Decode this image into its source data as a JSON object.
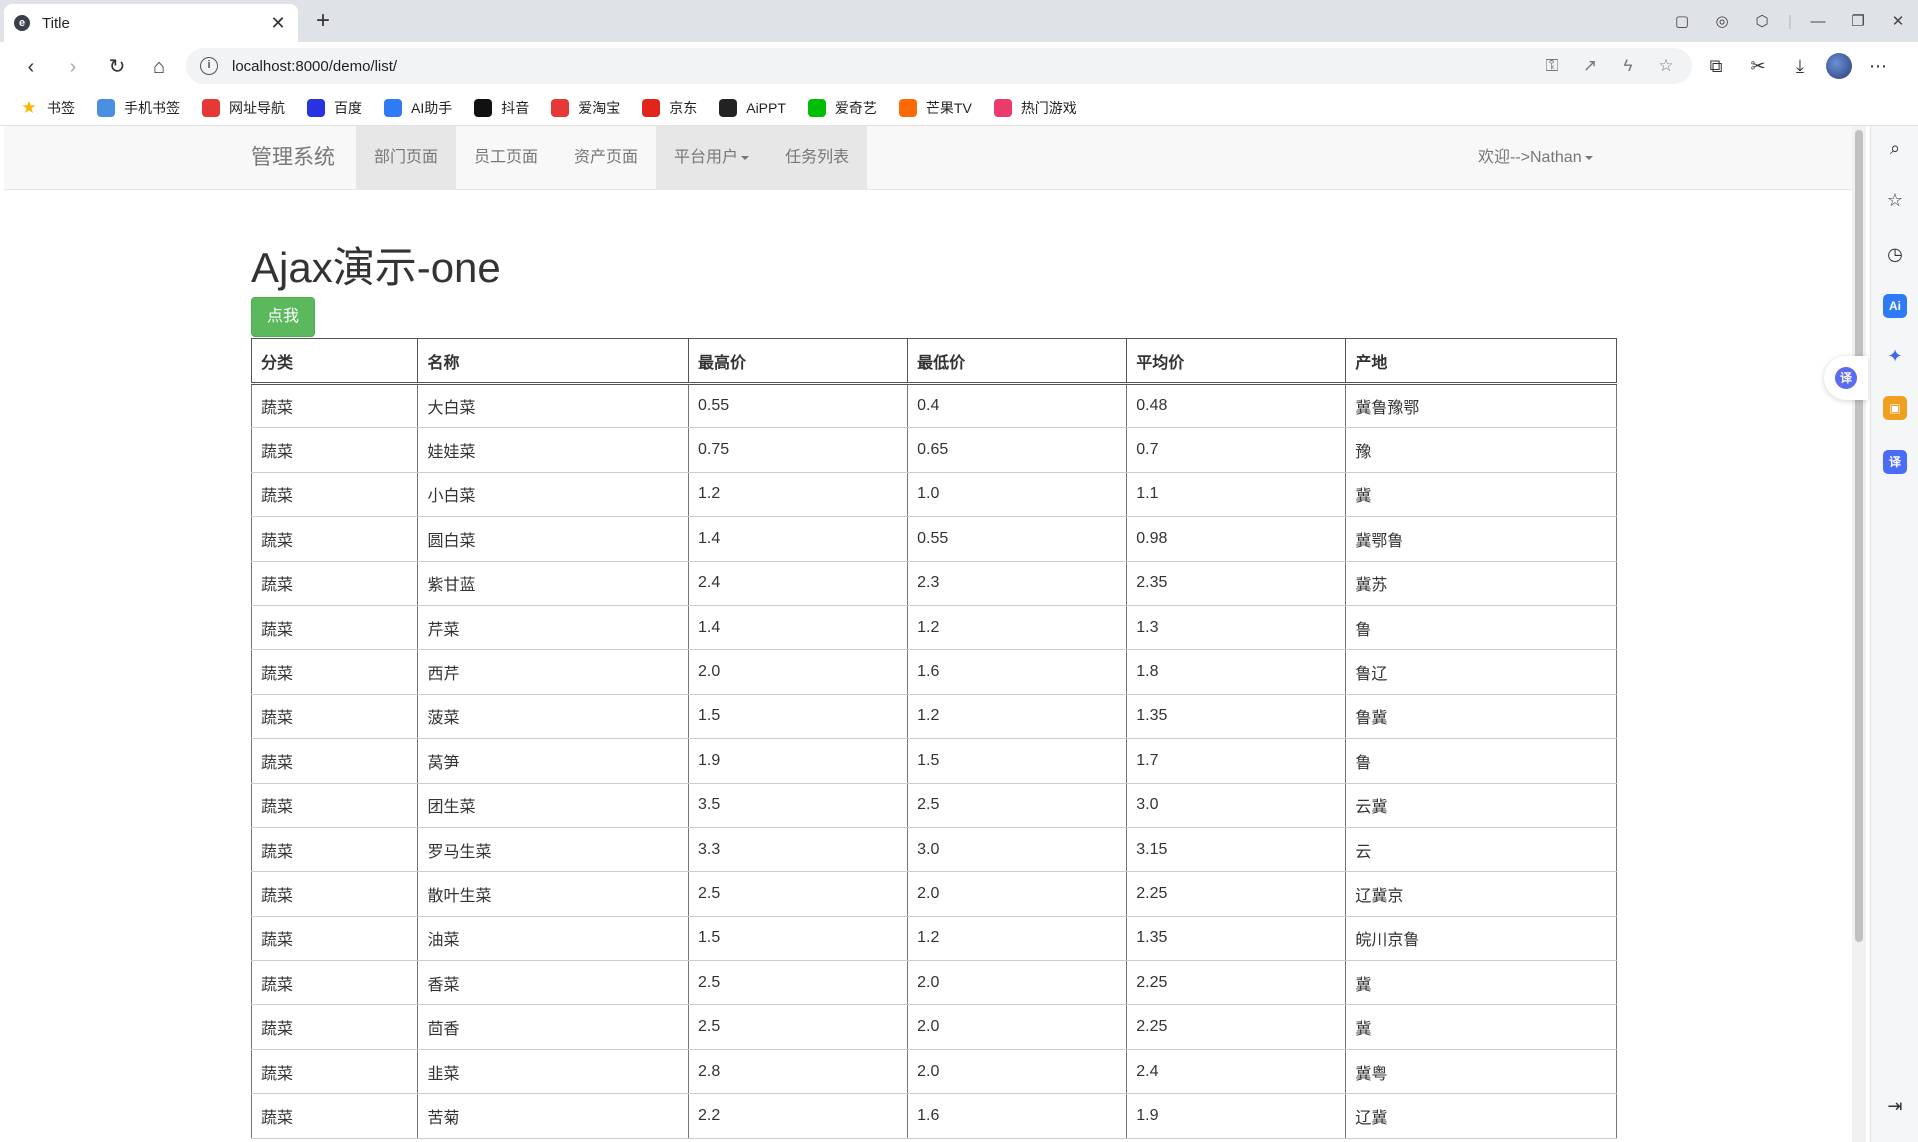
{
  "browser": {
    "tab_title": "Title",
    "url": "localhost:8000/demo/list/",
    "bookmarks": [
      {
        "label": "书签",
        "icon": "star-icon",
        "color": "#f5b800"
      },
      {
        "label": "手机书签",
        "icon": "phone-icon",
        "color": "#4a90e2"
      },
      {
        "label": "网址导航",
        "icon": "nav-icon",
        "color": "#e53935"
      },
      {
        "label": "百度",
        "icon": "baidu-icon",
        "color": "#2932e1"
      },
      {
        "label": "AI助手",
        "icon": "ai-icon",
        "color": "#2f7bf5"
      },
      {
        "label": "抖音",
        "icon": "douyin-icon",
        "color": "#111111"
      },
      {
        "label": "爱淘宝",
        "icon": "taobao-icon",
        "color": "#e53935"
      },
      {
        "label": "京东",
        "icon": "jd-icon",
        "color": "#e1251b"
      },
      {
        "label": "AiPPT",
        "icon": "aippt-icon",
        "color": "#222222"
      },
      {
        "label": "爱奇艺",
        "icon": "iqiyi-icon",
        "color": "#00be06"
      },
      {
        "label": "芒果TV",
        "icon": "mango-icon",
        "color": "#ff6a00"
      },
      {
        "label": "热门游戏",
        "icon": "game-icon",
        "color": "#ec3a6c"
      }
    ]
  },
  "app": {
    "brand": "管理系统",
    "nav": [
      "部门页面",
      "员工页面",
      "资产页面",
      "平台用户",
      "任务列表"
    ],
    "user": "欢迎-->Nathan"
  },
  "main": {
    "title": "Ajax演示-one",
    "button": "点我",
    "table": {
      "headers": [
        "分类",
        "名称",
        "最高价",
        "最低价",
        "平均价",
        "产地"
      ],
      "rows": [
        [
          "蔬菜",
          "大白菜",
          "0.55",
          "0.4",
          "0.48",
          "冀鲁豫鄂"
        ],
        [
          "蔬菜",
          "娃娃菜",
          "0.75",
          "0.65",
          "0.7",
          "豫"
        ],
        [
          "蔬菜",
          "小白菜",
          "1.2",
          "1.0",
          "1.1",
          "冀"
        ],
        [
          "蔬菜",
          "圆白菜",
          "1.4",
          "0.55",
          "0.98",
          "冀鄂鲁"
        ],
        [
          "蔬菜",
          "紫甘蓝",
          "2.4",
          "2.3",
          "2.35",
          "冀苏"
        ],
        [
          "蔬菜",
          "芹菜",
          "1.4",
          "1.2",
          "1.3",
          "鲁"
        ],
        [
          "蔬菜",
          "西芹",
          "2.0",
          "1.6",
          "1.8",
          "鲁辽"
        ],
        [
          "蔬菜",
          "菠菜",
          "1.5",
          "1.2",
          "1.35",
          "鲁冀"
        ],
        [
          "蔬菜",
          "莴笋",
          "1.9",
          "1.5",
          "1.7",
          "鲁"
        ],
        [
          "蔬菜",
          "团生菜",
          "3.5",
          "2.5",
          "3.0",
          "云冀"
        ],
        [
          "蔬菜",
          "罗马生菜",
          "3.3",
          "3.0",
          "3.15",
          "云"
        ],
        [
          "蔬菜",
          "散叶生菜",
          "2.5",
          "2.0",
          "2.25",
          "辽冀京"
        ],
        [
          "蔬菜",
          "油菜",
          "1.5",
          "1.2",
          "1.35",
          "皖川京鲁"
        ],
        [
          "蔬菜",
          "香菜",
          "2.5",
          "2.0",
          "2.25",
          "冀"
        ],
        [
          "蔬菜",
          "茴香",
          "2.5",
          "2.0",
          "2.25",
          "冀"
        ],
        [
          "蔬菜",
          "韭菜",
          "2.8",
          "2.0",
          "2.4",
          "冀粤"
        ],
        [
          "蔬菜",
          "苦菊",
          "2.2",
          "1.6",
          "1.9",
          "辽冀"
        ]
      ]
    }
  }
}
